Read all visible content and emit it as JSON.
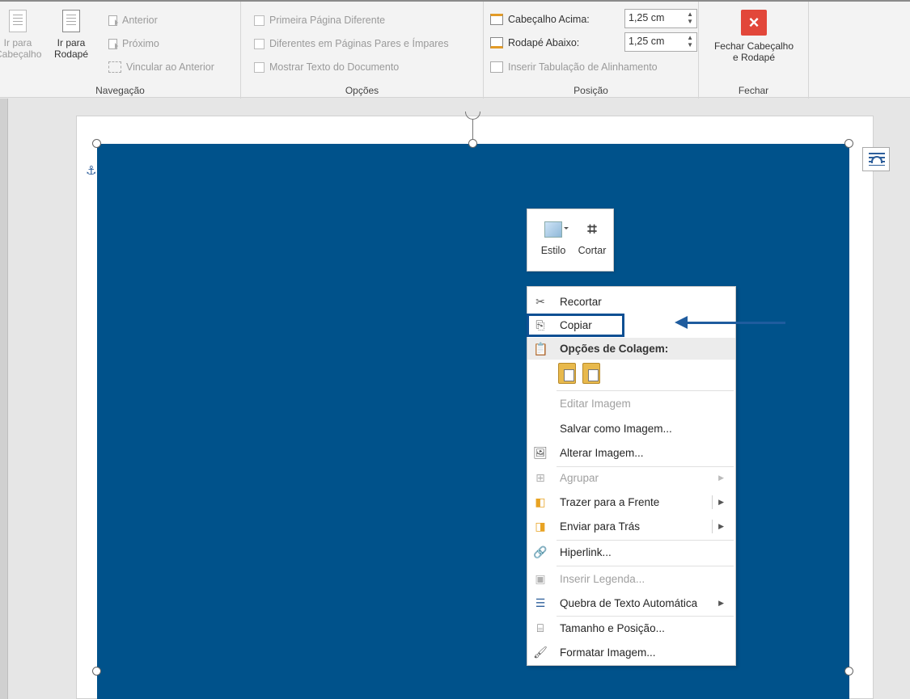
{
  "ribbon": {
    "navigation": {
      "goto_header_line1": "Ir para",
      "goto_header_line2": "Cabeçalho",
      "goto_footer_line1": "Ir para",
      "goto_footer_line2": "Rodapé",
      "previous": "Anterior",
      "next": "Próximo",
      "link_previous": "Vincular ao Anterior",
      "label": "Navegação"
    },
    "options": {
      "different_first_page": "Primeira Página Diferente",
      "different_odd_even": "Diferentes em Páginas Pares e Ímpares",
      "show_document_text": "Mostrar Texto do Documento",
      "label": "Opções"
    },
    "position": {
      "header_from_top_label": "Cabeçalho Acima:",
      "header_from_top_value": "1,25 cm",
      "footer_from_bottom_label": "Rodapé Abaixo:",
      "footer_from_bottom_value": "1,25 cm",
      "insert_alignment_tab": "Inserir Tabulação de Alinhamento",
      "label": "Posição"
    },
    "close": {
      "button_line1": "Fechar Cabeçalho",
      "button_line2": "e Rodapé",
      "label": "Fechar"
    }
  },
  "mini_toolbar": {
    "style": "Estilo",
    "crop": "Cortar"
  },
  "context_menu": {
    "cut": "Recortar",
    "copy": "Copiar",
    "paste_options": "Opções de Colagem:",
    "edit_image": "Editar Imagem",
    "save_as_image": "Salvar como Imagem...",
    "change_image": "Alterar Imagem...",
    "group": "Agrupar",
    "bring_to_front": "Trazer para a Frente",
    "send_to_back": "Enviar para Trás",
    "hyperlink": "Hiperlink...",
    "insert_caption": "Inserir Legenda...",
    "wrap_text": "Quebra de Texto Automática",
    "size_position": "Tamanho e Posição...",
    "format_image": "Formatar Imagem..."
  },
  "colors": {
    "image_fill": "#00528b",
    "highlight": "#0e4f93",
    "close_button": "#e2473a"
  }
}
